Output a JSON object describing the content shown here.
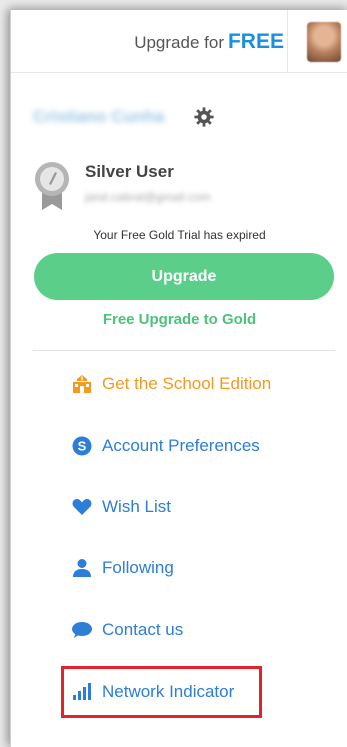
{
  "header": {
    "upgrade_prefix": "Upgrade for",
    "upgrade_free": "FREE"
  },
  "user": {
    "name": "Cristiano Cunha",
    "tier": "Silver User",
    "email": "jand.cabral@gmail.com"
  },
  "trial": {
    "message": "Your Free Gold Trial has expired",
    "upgrade_button": "Upgrade",
    "free_upgrade_link": "Free Upgrade to Gold"
  },
  "menu": [
    {
      "label": "Get the School Edition",
      "icon": "school-icon"
    },
    {
      "label": "Account Preferences",
      "icon": "account-icon"
    },
    {
      "label": "Wish List",
      "icon": "heart-icon"
    },
    {
      "label": "Following",
      "icon": "person-icon"
    },
    {
      "label": "Contact us",
      "icon": "chat-bubble-icon"
    },
    {
      "label": "Network Indicator",
      "icon": "signal-bars-icon"
    }
  ],
  "colors": {
    "accent_blue": "#2c7ed6",
    "upgrade_green": "#5bcf8a",
    "school_orange": "#f39a1f",
    "highlight_red": "#e1232b"
  }
}
